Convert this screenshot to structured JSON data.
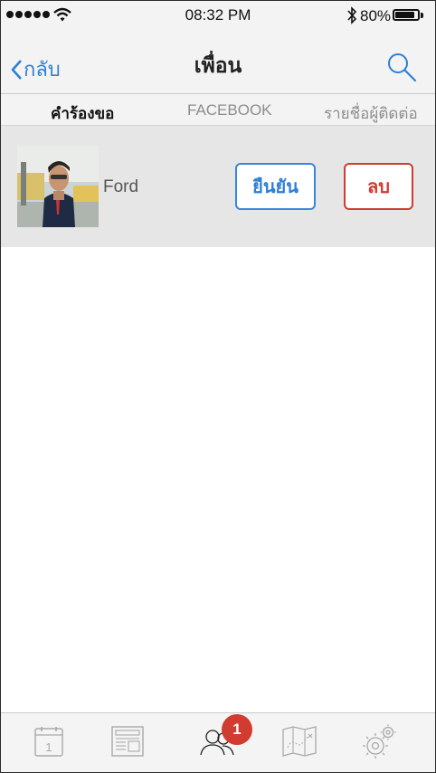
{
  "status_bar": {
    "time": "08:32 PM",
    "battery_percent": "80%",
    "battery_level": 0.8,
    "signal_bars": 5
  },
  "nav": {
    "back_label": "กลับ",
    "title": "เพื่อน",
    "back_icon": "chevron-left-icon",
    "search_icon": "search-icon"
  },
  "tabs": [
    {
      "label": "คำร้องขอ",
      "active": true
    },
    {
      "label": "FACEBOOK",
      "active": false
    },
    {
      "label": "รายชื่อผู้ติดต่อ",
      "active": false
    }
  ],
  "requests": [
    {
      "name": "Ford",
      "confirm_label": "ยืนยัน",
      "delete_label": "ลบ"
    }
  ],
  "tabbar": {
    "calendar_day": "1",
    "friends_badge": "1",
    "items": [
      "calendar-icon",
      "news-icon",
      "friends-icon",
      "map-icon",
      "settings-icon"
    ]
  },
  "colors": {
    "accent": "#2e7fd6",
    "danger": "#d03c30",
    "badge": "#d23b2f"
  }
}
